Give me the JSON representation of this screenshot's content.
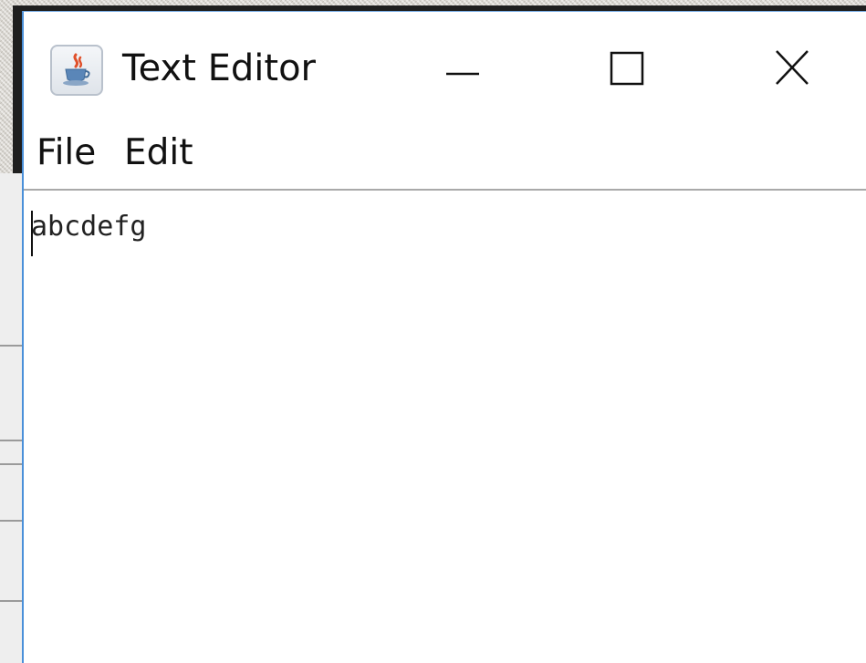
{
  "window": {
    "title": "Text Editor",
    "controls": {
      "minimize": "minimize-icon",
      "maximize": "maximize-icon",
      "close": "close-icon"
    },
    "app_icon": "java-coffee-cup-icon"
  },
  "menubar": {
    "items": [
      {
        "label": "File"
      },
      {
        "label": "Edit"
      }
    ]
  },
  "editor": {
    "content": "abcdefg"
  },
  "colors": {
    "window_border": "#4a90d9",
    "background_window": "#1f1f1f",
    "desktop": "#d9d6cf",
    "text": "#111111"
  }
}
